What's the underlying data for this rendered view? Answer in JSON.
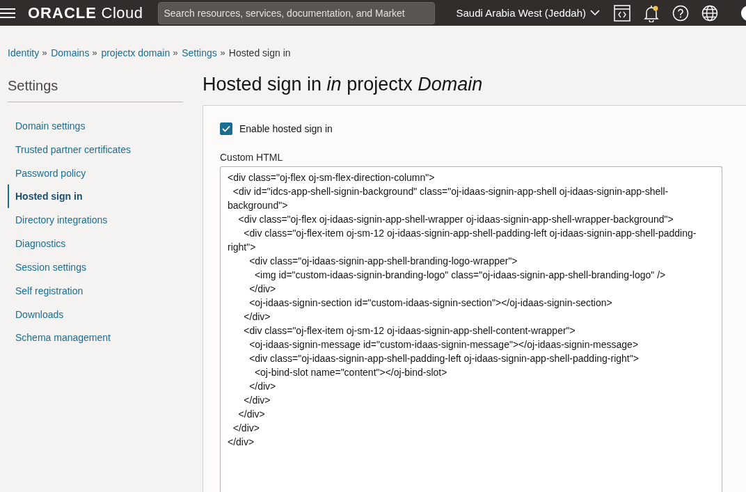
{
  "header": {
    "logo_brand": "ORACLE",
    "logo_product": "Cloud",
    "search": {
      "placeholder": "Search resources, services, documentation, and Market"
    },
    "region": "Saudi Arabia West (Jeddah)",
    "notification_unread": true
  },
  "breadcrumbs": [
    {
      "label": "Identity",
      "link": true
    },
    {
      "label": "Domains",
      "link": true
    },
    {
      "label": "projectx domain",
      "link": true
    },
    {
      "label": "Settings",
      "link": true
    },
    {
      "label": "Hosted sign in",
      "link": false
    }
  ],
  "sidebar": {
    "title": "Settings",
    "items": [
      {
        "label": "Domain settings",
        "selected": false
      },
      {
        "label": "Trusted partner certificates",
        "selected": false
      },
      {
        "label": "Password policy",
        "selected": false
      },
      {
        "label": "Hosted sign in",
        "selected": true
      },
      {
        "label": "Directory integrations",
        "selected": false
      },
      {
        "label": "Diagnostics",
        "selected": false
      },
      {
        "label": "Session settings",
        "selected": false
      },
      {
        "label": "Self registration",
        "selected": false
      },
      {
        "label": "Downloads",
        "selected": false
      },
      {
        "label": "Schema management",
        "selected": false
      }
    ]
  },
  "page_title": "Hosted sign in *in* projectx *Domain*",
  "form": {
    "enable_checkbox": {
      "label": "Enable hosted sign in",
      "checked": true
    },
    "custom_html": {
      "label": "Custom HTML",
      "lines": [
        "<div class=\"oj-flex oj-sm-flex-direction-column\">",
        "  <div id=\"idcs-app-shell-signin-background\" class=\"oj-idaas-signin-app-shell oj-idaas-signin-app-shell-background\">",
        "    <div class=\"oj-flex oj-idaas-signin-app-shell-wrapper oj-idaas-signin-app-shell-wrapper-background\">",
        "      <div class=\"oj-flex-item oj-sm-12 oj-idaas-signin-app-shell-padding-left oj-idaas-signin-app-shell-padding-right\">",
        "        <div class=\"oj-idaas-signin-app-shell-branding-logo-wrapper\">",
        "          <img id=\"custom-idaas-signin-branding-logo\" class=\"oj-idaas-signin-app-shell-branding-logo\" />",
        "        </div>",
        "        <oj-idaas-signin-section id=\"custom-idaas-signin-section\"></oj-idaas-signin-section>",
        "      </div>",
        "      <div class=\"oj-flex-item oj-sm-12 oj-idaas-signin-app-shell-content-wrapper\">",
        "        <oj-idaas-signin-message id=\"custom-idaas-signin-message\"></oj-idaas-signin-message>",
        "        <div class=\"oj-idaas-signin-app-shell-padding-left oj-idaas-signin-app-shell-padding-right\">",
        "          <oj-bind-slot name=\"content\"></oj-bind-slot>",
        "        </div>",
        "      </div>",
        "    </div>",
        "  </div>",
        "</div>"
      ]
    }
  }
}
